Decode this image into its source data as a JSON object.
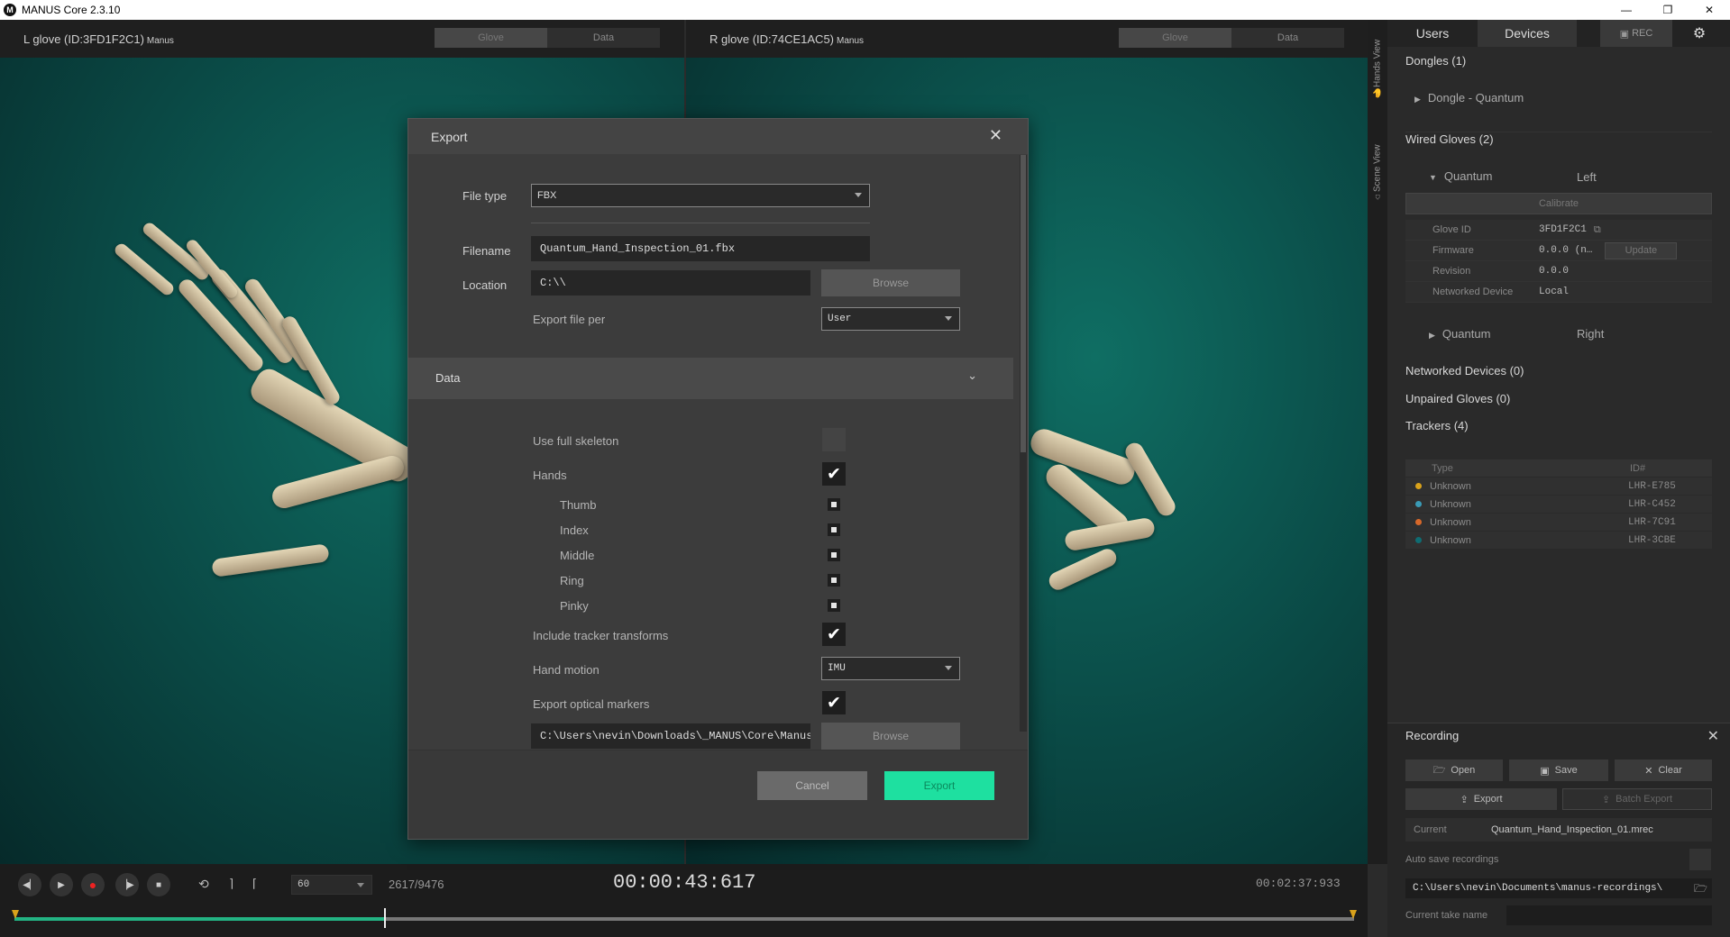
{
  "window": {
    "title": "MANUS Core 2.3.10",
    "min": "—",
    "restore": "❐",
    "close": "✕"
  },
  "viewports": {
    "left": {
      "title": "L glove (ID:3FD1F2C1)",
      "brand": "Manus",
      "tab_glove": "Glove",
      "tab_data": "Data"
    },
    "right": {
      "title": "R glove (ID:74CE1AC5)",
      "brand": "Manus",
      "tab_glove": "Glove",
      "tab_data": "Data"
    }
  },
  "sidetabs": {
    "hands_view": "Hands View",
    "scene_view": "Scene View"
  },
  "panel": {
    "tabs": {
      "users": "Users",
      "devices": "Devices",
      "rec": "REC"
    },
    "dongles_header": "Dongles (1)",
    "dongle_item": "Dongle - Quantum",
    "wired_header": "Wired Gloves (2)",
    "quantum_left": {
      "name": "Quantum",
      "side": "Left"
    },
    "calibrate": "Calibrate",
    "details": [
      {
        "key": "Glove ID",
        "value": "3FD1F2C1"
      },
      {
        "key": "Firmware",
        "value": "0.0.0 (n…"
      },
      {
        "key": "Revision",
        "value": "0.0.0"
      },
      {
        "key": "Networked Device",
        "value": "Local"
      }
    ],
    "update": "Update",
    "quantum_right": {
      "name": "Quantum",
      "side": "Right"
    },
    "networked_header": "Networked Devices (0)",
    "unpaired_header": "Unpaired Gloves (0)",
    "trackers_header": "Trackers (4)",
    "trackers_cols": {
      "type": "Type",
      "id": "ID#"
    },
    "trackers": [
      {
        "type": "Unknown",
        "id": "LHR-E785",
        "color": "#d9a21b"
      },
      {
        "type": "Unknown",
        "id": "LHR-C452",
        "color": "#3a9bb6"
      },
      {
        "type": "Unknown",
        "id": "LHR-7C91",
        "color": "#d7682a"
      },
      {
        "type": "Unknown",
        "id": "LHR-3CBE",
        "color": "#0f6c72"
      }
    ]
  },
  "recording": {
    "title": "Recording",
    "open": "Open",
    "save": "Save",
    "clear": "Clear",
    "export": "Export",
    "batch_export": "Batch Export",
    "current_label": "Current",
    "current_value": "Quantum_Hand_Inspection_01.mrec",
    "autosave_label": "Auto save recordings",
    "path": "C:\\Users\\nevin\\Documents\\manus-recordings\\",
    "take_label": "Current take name"
  },
  "transport": {
    "fps": "60",
    "frames": "2617/9476",
    "time_current": "00:00:43:617",
    "time_total": "00:02:37:933",
    "progress": 0.2762
  },
  "export_dialog": {
    "title": "Export",
    "file_type_label": "File type",
    "file_type_value": "FBX",
    "filename_label": "Filename",
    "filename_value": "Quantum_Hand_Inspection_01.fbx",
    "location_label": "Location",
    "location_value": "C:\\\\",
    "browse": "Browse",
    "export_per_label": "Export file per",
    "export_per_value": "User",
    "data_header": "Data",
    "use_full_skeleton": "Use full skeleton",
    "hands": "Hands",
    "fingers": [
      "Thumb",
      "Index",
      "Middle",
      "Ring",
      "Pinky"
    ],
    "include_tracker": "Include tracker transforms",
    "hand_motion_label": "Hand motion",
    "hand_motion_value": "IMU",
    "optical_markers": "Export optical markers",
    "markers_path": "C:\\Users\\nevin\\Downloads\\_MANUS\\Core\\Manus",
    "browse2": "Browse",
    "cancel": "Cancel",
    "export": "Export",
    "accent": "#1ee0a0"
  }
}
